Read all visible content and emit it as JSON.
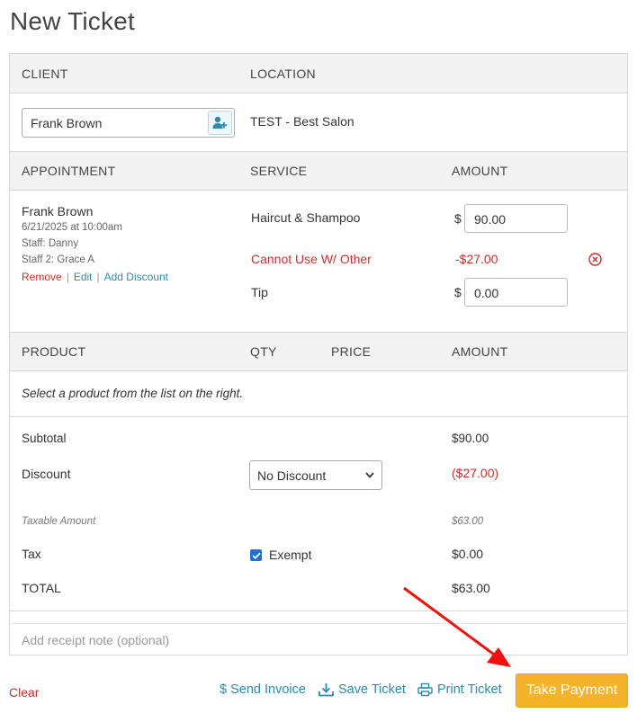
{
  "page_title": "New Ticket",
  "client_section": {
    "client_header": "CLIENT",
    "location_header": "LOCATION",
    "client_value": "Frank Brown",
    "location_value": "TEST - Best Salon",
    "client_icon": "add-user-icon"
  },
  "appointment_section": {
    "appointment_header": "APPOINTMENT",
    "service_header": "SERVICE",
    "amount_header": "AMOUNT",
    "client_name": "Frank Brown",
    "datetime": "6/21/2025 at 10:00am",
    "staff": "Staff: Danny",
    "staff2": "Staff 2: Grace A",
    "remove_label": "Remove",
    "edit_label": "Edit",
    "add_discount_label": "Add Discount",
    "service_name": "Haircut & Shampoo",
    "currency_symbol": "$",
    "service_amount": "90.00",
    "discount_name": "Cannot Use W/ Other",
    "discount_amount": "-$27.00",
    "tip_label": "Tip",
    "tip_amount": "0.00"
  },
  "product_section": {
    "product_header": "PRODUCT",
    "qty_header": "QTY",
    "price_header": "PRICE",
    "amount_header": "AMOUNT",
    "empty_message": "Select a product from the list on the right."
  },
  "totals": {
    "subtotal_label": "Subtotal",
    "subtotal_value": "$90.00",
    "discount_label": "Discount",
    "discount_select_value": "No Discount",
    "discount_value": "($27.00)",
    "taxable_label": "Taxable Amount",
    "taxable_value": "$63.00",
    "tax_label": "Tax",
    "exempt_label": "Exempt",
    "exempt_checked": true,
    "tax_value": "$0.00",
    "total_label": "TOTAL",
    "total_value": "$63.00"
  },
  "receipt_note_placeholder": "Add receipt note (optional)",
  "footer": {
    "clear_label": "Clear",
    "send_invoice_label": "$ Send Invoice",
    "save_ticket_label": "Save Ticket",
    "print_ticket_label": "Print Ticket",
    "take_payment_label": "Take Payment"
  },
  "colors": {
    "accent_blue": "#2a8bab",
    "danger_red": "#c9302c",
    "pay_button": "#f5b32a",
    "arrow_red": "#f01010"
  }
}
